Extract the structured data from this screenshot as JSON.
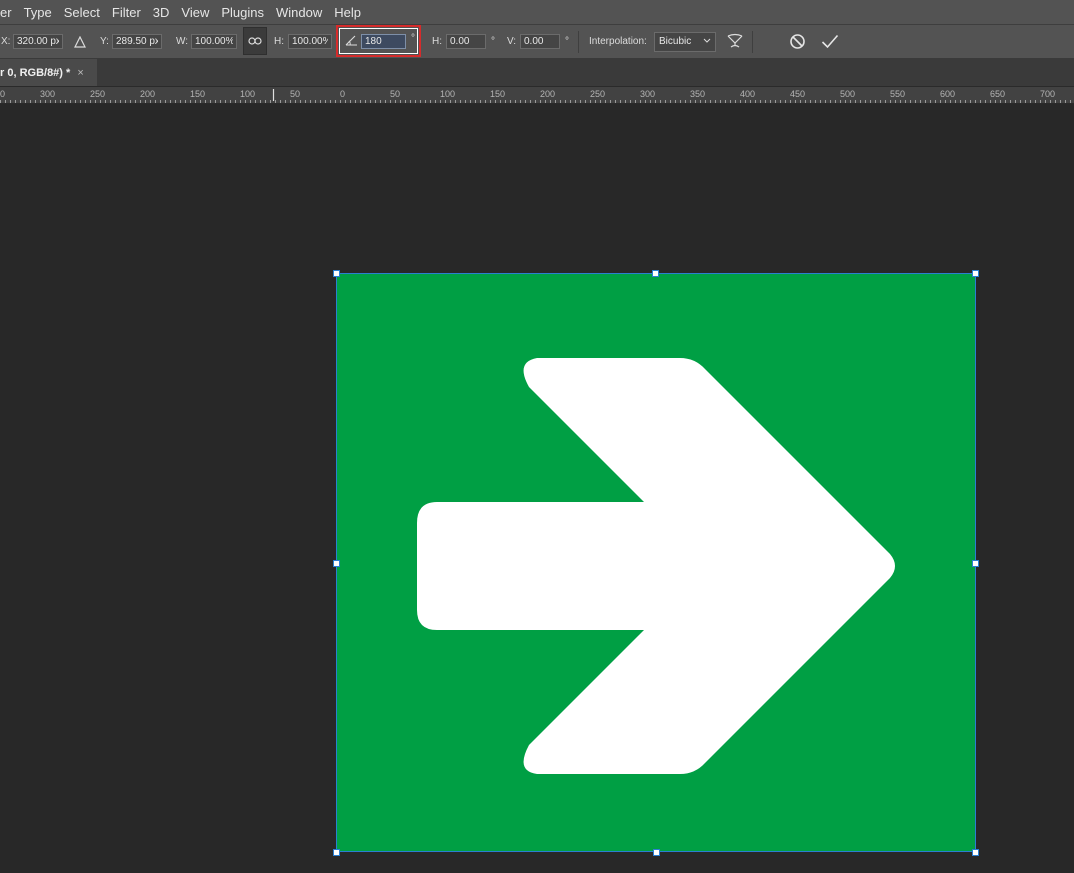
{
  "menu": [
    "er",
    "Type",
    "Select",
    "Filter",
    "3D",
    "View",
    "Plugins",
    "Window",
    "Help"
  ],
  "options": {
    "x_label": "X:",
    "x_value": "320.00 px",
    "y_label": "Y:",
    "y_value": "289.50 px",
    "w_label": "W:",
    "w_value": "100.00%",
    "h_label": "H:",
    "h_value": "100.00%",
    "rotate_value": "180",
    "degree_symbol": "°",
    "skew_h_label": "H:",
    "skew_h_value": "0.00",
    "skew_v_label": "V:",
    "skew_v_value": "0.00",
    "interpolation_label": "Interpolation:",
    "interpolation_value": "Bicubic"
  },
  "document_tab": {
    "title": "r 0, RGB/8#) *",
    "close": "×"
  },
  "ruler": {
    "labels": [
      "0",
      "300",
      "250",
      "200",
      "150",
      "100",
      "50",
      "0",
      "50",
      "100",
      "150",
      "200",
      "250",
      "300",
      "350",
      "400",
      "450",
      "500",
      "550",
      "600",
      "650",
      "700"
    ]
  },
  "colors": {
    "layer_fill": "#009f44",
    "arrow_fill": "#ffffff",
    "selection": "#2b7fd1",
    "highlight": "#d62b2b"
  },
  "icons": [
    "reference-point-icon",
    "link-icon",
    "rotate-angle-icon",
    "warp-icon",
    "cancel-icon",
    "commit-icon"
  ]
}
